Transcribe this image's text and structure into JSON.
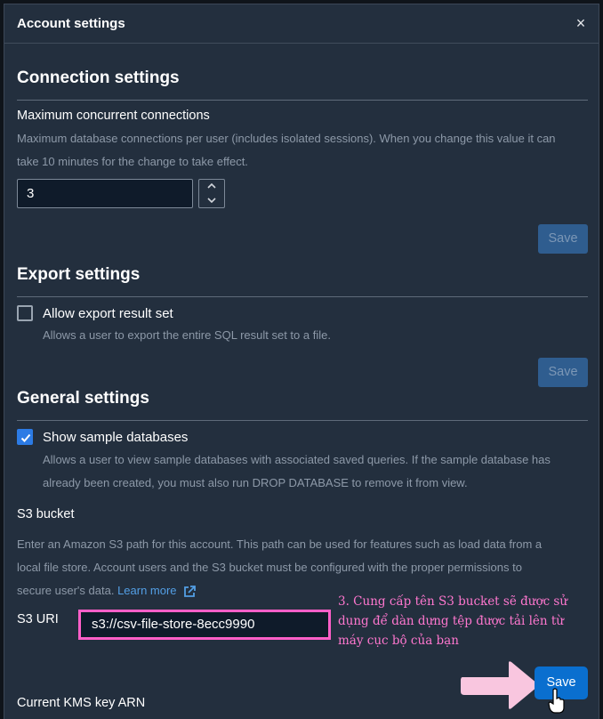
{
  "dialog": {
    "title": "Account settings",
    "close_symbol": "×"
  },
  "connection": {
    "section_title": "Connection settings",
    "max_label": "Maximum concurrent connections",
    "max_desc_line1": "Maximum database connections per user (includes isolated sessions). When you change this value it can",
    "max_desc_line2": "take 10 minutes for the change to take effect.",
    "max_value": "3",
    "save_label": "Save"
  },
  "export": {
    "section_title": "Export settings",
    "checkbox_label": "Allow export result set",
    "checkbox_checked": false,
    "checkbox_desc": "Allows a user to export the entire SQL result set to a file.",
    "save_label": "Save"
  },
  "general": {
    "section_title": "General settings",
    "checkbox_label": "Show sample databases",
    "checkbox_checked": true,
    "checkbox_desc_line1": "Allows a user to view sample databases with associated saved queries. If the sample database has",
    "checkbox_desc_line2": "already been created, you must also run DROP DATABASE to remove it from view.",
    "s3_heading": "S3 bucket",
    "s3_desc_line1": "Enter an Amazon S3 path for this account. This path can be used for features such as load data from a",
    "s3_desc_line2": "local file store. Account users and the S3 bucket must be configured with the proper permissions to",
    "s3_desc_line3": "secure user's data.",
    "learn_more": "Learn more",
    "s3_uri_label": "S3 URI",
    "s3_uri_value": "s3://csv-file-store-8ecc9990",
    "save_label": "Save",
    "kms_label": "Current KMS key ARN"
  },
  "annotation": {
    "line1": "3. Cung cấp tên S3 bucket sẽ được sử",
    "line2": "dụng để dàn dựng tệp được tải lên từ",
    "line3": "máy cục bộ của bạn"
  },
  "colors": {
    "primary_button": "#0a6fcf",
    "disabled_button": "#2f5d8f",
    "highlight": "#ff5fc8",
    "link": "#539fe5"
  },
  "icons": [
    "close-icon",
    "chevron-up-icon",
    "chevron-down-icon",
    "check-icon",
    "external-link-icon",
    "arrow-icon",
    "hand-cursor-icon"
  ]
}
